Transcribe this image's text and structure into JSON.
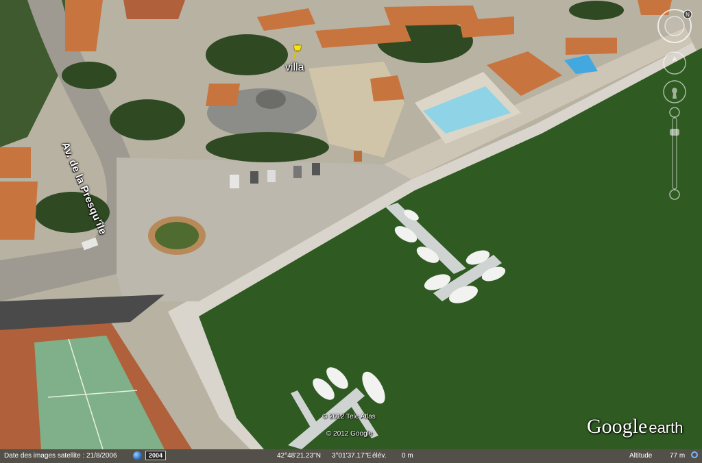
{
  "placemark": {
    "label": "villa",
    "icon": "yellow-pushpin-icon",
    "color": "#f5e21b"
  },
  "map": {
    "street_label": "Av. de la Presqu'île",
    "copyrights": [
      "© 2012 Tele Atlas",
      "© 2012 Google"
    ],
    "brand": {
      "main": "Google",
      "sub": "earth"
    },
    "colors": {
      "water": "#2f5a22",
      "pool": "#8fd3e6",
      "roof": "#c8743e",
      "pavement": "#c8c4bb",
      "tennis_court": "#7fb08a"
    }
  },
  "navigation": {
    "north_label": "N",
    "icons": [
      "compass-icon",
      "look-joystick-icon",
      "move-joystick-icon",
      "zoom-in-icon",
      "zoom-slider-icon",
      "zoom-out-icon"
    ]
  },
  "status": {
    "imagery_date": "Date des images satellite : 21/8/2006",
    "imagery_year": "2004",
    "latitude": "42°48'21.23\"N",
    "longitude": "3°01'37.17\"E",
    "elevation_label": "élév.",
    "elevation_value": "0 m",
    "altitude_label": "Altitude",
    "altitude_value": "77 m"
  }
}
